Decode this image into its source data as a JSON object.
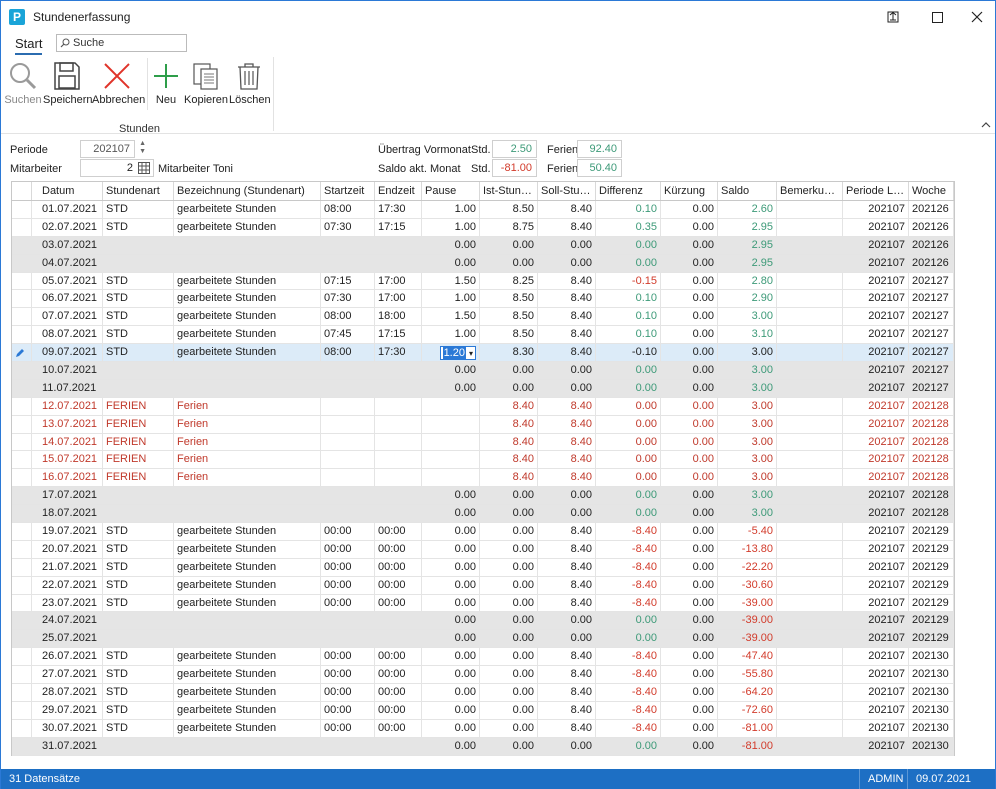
{
  "window": {
    "logo": "P",
    "title": "Stundenerfassung",
    "controls": [
      "restore-icon",
      "maximize-icon",
      "close-icon"
    ]
  },
  "ribbon": {
    "tab": "Start",
    "search_placeholder": "Suche",
    "buttons": {
      "suchen": "Suchen",
      "speichern": "Speichern",
      "abbrechen": "Abbrechen",
      "neu": "Neu",
      "kopieren": "Kopieren",
      "loeschen": "Löschen"
    },
    "group": "Stunden"
  },
  "form": {
    "periode_label": "Periode",
    "periode_value": "202107",
    "mitarbeiter_label": "Mitarbeiter",
    "mitarbeiter_value": "2",
    "mitarbeiter_name": "Mitarbeiter Toni",
    "uebertrag_label": "Übertrag Vormonat",
    "saldo_label": "Saldo akt. Monat",
    "std_label": "Std.",
    "ferien_label": "Ferien",
    "uebertrag_std": "2.50",
    "uebertrag_ferien": "92.40",
    "saldo_std": "-81.00",
    "saldo_ferien": "50.40"
  },
  "grid": {
    "columns": [
      "Datum",
      "Stundenart",
      "Bezeichnung (Stundenart)",
      "Startzeit",
      "Endzeit",
      "Pause",
      "Ist-Stunden",
      "Soll-Stund...",
      "Differenz",
      "Kürzung",
      "Saldo",
      "Bemerkungen",
      "Periode Lohn",
      "Woche"
    ],
    "rows": [
      {
        "t": "work",
        "datum": "01.07.2021",
        "art": "STD",
        "bez": "gearbeitete Stunden",
        "start": "08:00",
        "end": "17:30",
        "pause": "1.00",
        "ist": "8.50",
        "soll": "8.40",
        "diff": "0.10",
        "kurz": "0.00",
        "saldo": "2.60",
        "bem": "",
        "per": "202107",
        "woche": "202126"
      },
      {
        "t": "work",
        "datum": "02.07.2021",
        "art": "STD",
        "bez": "gearbeitete Stunden",
        "start": "07:30",
        "end": "17:15",
        "pause": "1.00",
        "ist": "8.75",
        "soll": "8.40",
        "diff": "0.35",
        "kurz": "0.00",
        "saldo": "2.95",
        "bem": "",
        "per": "202107",
        "woche": "202126"
      },
      {
        "t": "weekend",
        "datum": "03.07.2021",
        "art": "",
        "bez": "",
        "start": "",
        "end": "",
        "pause": "0.00",
        "ist": "0.00",
        "soll": "0.00",
        "diff": "0.00",
        "kurz": "0.00",
        "saldo": "2.95",
        "bem": "",
        "per": "202107",
        "woche": "202126"
      },
      {
        "t": "weekend",
        "datum": "04.07.2021",
        "art": "",
        "bez": "",
        "start": "",
        "end": "",
        "pause": "0.00",
        "ist": "0.00",
        "soll": "0.00",
        "diff": "0.00",
        "kurz": "0.00",
        "saldo": "2.95",
        "bem": "",
        "per": "202107",
        "woche": "202126"
      },
      {
        "t": "work",
        "datum": "05.07.2021",
        "art": "STD",
        "bez": "gearbeitete Stunden",
        "start": "07:15",
        "end": "17:00",
        "pause": "1.50",
        "ist": "8.25",
        "soll": "8.40",
        "diff": "-0.15",
        "kurz": "0.00",
        "saldo": "2.80",
        "bem": "",
        "per": "202107",
        "woche": "202127"
      },
      {
        "t": "work",
        "datum": "06.07.2021",
        "art": "STD",
        "bez": "gearbeitete Stunden",
        "start": "07:30",
        "end": "17:00",
        "pause": "1.00",
        "ist": "8.50",
        "soll": "8.40",
        "diff": "0.10",
        "kurz": "0.00",
        "saldo": "2.90",
        "bem": "",
        "per": "202107",
        "woche": "202127"
      },
      {
        "t": "work",
        "datum": "07.07.2021",
        "art": "STD",
        "bez": "gearbeitete Stunden",
        "start": "08:00",
        "end": "18:00",
        "pause": "1.50",
        "ist": "8.50",
        "soll": "8.40",
        "diff": "0.10",
        "kurz": "0.00",
        "saldo": "3.00",
        "bem": "",
        "per": "202107",
        "woche": "202127"
      },
      {
        "t": "work",
        "datum": "08.07.2021",
        "art": "STD",
        "bez": "gearbeitete Stunden",
        "start": "07:45",
        "end": "17:15",
        "pause": "1.00",
        "ist": "8.50",
        "soll": "8.40",
        "diff": "0.10",
        "kurz": "0.00",
        "saldo": "3.10",
        "bem": "",
        "per": "202107",
        "woche": "202127"
      },
      {
        "t": "sel",
        "datum": "09.07.2021",
        "art": "STD",
        "bez": "gearbeitete Stunden",
        "start": "08:00",
        "end": "17:30",
        "pause": "1.20",
        "ist": "8.30",
        "soll": "8.40",
        "diff": "-0.10",
        "kurz": "0.00",
        "saldo": "3.00",
        "bem": "",
        "per": "202107",
        "woche": "202127"
      },
      {
        "t": "weekend",
        "datum": "10.07.2021",
        "art": "",
        "bez": "",
        "start": "",
        "end": "",
        "pause": "0.00",
        "ist": "0.00",
        "soll": "0.00",
        "diff": "0.00",
        "kurz": "0.00",
        "saldo": "3.00",
        "bem": "",
        "per": "202107",
        "woche": "202127"
      },
      {
        "t": "weekend",
        "datum": "11.07.2021",
        "art": "",
        "bez": "",
        "start": "",
        "end": "",
        "pause": "0.00",
        "ist": "0.00",
        "soll": "0.00",
        "diff": "0.00",
        "kurz": "0.00",
        "saldo": "3.00",
        "bem": "",
        "per": "202107",
        "woche": "202127"
      },
      {
        "t": "ferien",
        "datum": "12.07.2021",
        "art": "FERIEN",
        "bez": "Ferien",
        "start": "",
        "end": "",
        "pause": "",
        "ist": "8.40",
        "soll": "8.40",
        "diff": "0.00",
        "kurz": "0.00",
        "saldo": "3.00",
        "bem": "",
        "per": "202107",
        "woche": "202128"
      },
      {
        "t": "ferien",
        "datum": "13.07.2021",
        "art": "FERIEN",
        "bez": "Ferien",
        "start": "",
        "end": "",
        "pause": "",
        "ist": "8.40",
        "soll": "8.40",
        "diff": "0.00",
        "kurz": "0.00",
        "saldo": "3.00",
        "bem": "",
        "per": "202107",
        "woche": "202128"
      },
      {
        "t": "ferien",
        "datum": "14.07.2021",
        "art": "FERIEN",
        "bez": "Ferien",
        "start": "",
        "end": "",
        "pause": "",
        "ist": "8.40",
        "soll": "8.40",
        "diff": "0.00",
        "kurz": "0.00",
        "saldo": "3.00",
        "bem": "",
        "per": "202107",
        "woche": "202128"
      },
      {
        "t": "ferien",
        "datum": "15.07.2021",
        "art": "FERIEN",
        "bez": "Ferien",
        "start": "",
        "end": "",
        "pause": "",
        "ist": "8.40",
        "soll": "8.40",
        "diff": "0.00",
        "kurz": "0.00",
        "saldo": "3.00",
        "bem": "",
        "per": "202107",
        "woche": "202128"
      },
      {
        "t": "ferien",
        "datum": "16.07.2021",
        "art": "FERIEN",
        "bez": "Ferien",
        "start": "",
        "end": "",
        "pause": "",
        "ist": "8.40",
        "soll": "8.40",
        "diff": "0.00",
        "kurz": "0.00",
        "saldo": "3.00",
        "bem": "",
        "per": "202107",
        "woche": "202128"
      },
      {
        "t": "weekend",
        "datum": "17.07.2021",
        "art": "",
        "bez": "",
        "start": "",
        "end": "",
        "pause": "0.00",
        "ist": "0.00",
        "soll": "0.00",
        "diff": "0.00",
        "kurz": "0.00",
        "saldo": "3.00",
        "bem": "",
        "per": "202107",
        "woche": "202128"
      },
      {
        "t": "weekend",
        "datum": "18.07.2021",
        "art": "",
        "bez": "",
        "start": "",
        "end": "",
        "pause": "0.00",
        "ist": "0.00",
        "soll": "0.00",
        "diff": "0.00",
        "kurz": "0.00",
        "saldo": "3.00",
        "bem": "",
        "per": "202107",
        "woche": "202128"
      },
      {
        "t": "work",
        "datum": "19.07.2021",
        "art": "STD",
        "bez": "gearbeitete Stunden",
        "start": "00:00",
        "end": "00:00",
        "pause": "0.00",
        "ist": "0.00",
        "soll": "8.40",
        "diff": "-8.40",
        "kurz": "0.00",
        "saldo": "-5.40",
        "bem": "",
        "per": "202107",
        "woche": "202129"
      },
      {
        "t": "work",
        "datum": "20.07.2021",
        "art": "STD",
        "bez": "gearbeitete Stunden",
        "start": "00:00",
        "end": "00:00",
        "pause": "0.00",
        "ist": "0.00",
        "soll": "8.40",
        "diff": "-8.40",
        "kurz": "0.00",
        "saldo": "-13.80",
        "bem": "",
        "per": "202107",
        "woche": "202129"
      },
      {
        "t": "work",
        "datum": "21.07.2021",
        "art": "STD",
        "bez": "gearbeitete Stunden",
        "start": "00:00",
        "end": "00:00",
        "pause": "0.00",
        "ist": "0.00",
        "soll": "8.40",
        "diff": "-8.40",
        "kurz": "0.00",
        "saldo": "-22.20",
        "bem": "",
        "per": "202107",
        "woche": "202129"
      },
      {
        "t": "work",
        "datum": "22.07.2021",
        "art": "STD",
        "bez": "gearbeitete Stunden",
        "start": "00:00",
        "end": "00:00",
        "pause": "0.00",
        "ist": "0.00",
        "soll": "8.40",
        "diff": "-8.40",
        "kurz": "0.00",
        "saldo": "-30.60",
        "bem": "",
        "per": "202107",
        "woche": "202129"
      },
      {
        "t": "work",
        "datum": "23.07.2021",
        "art": "STD",
        "bez": "gearbeitete Stunden",
        "start": "00:00",
        "end": "00:00",
        "pause": "0.00",
        "ist": "0.00",
        "soll": "8.40",
        "diff": "-8.40",
        "kurz": "0.00",
        "saldo": "-39.00",
        "bem": "",
        "per": "202107",
        "woche": "202129"
      },
      {
        "t": "weekend",
        "datum": "24.07.2021",
        "art": "",
        "bez": "",
        "start": "",
        "end": "",
        "pause": "0.00",
        "ist": "0.00",
        "soll": "0.00",
        "diff": "0.00",
        "kurz": "0.00",
        "saldo": "-39.00",
        "bem": "",
        "per": "202107",
        "woche": "202129"
      },
      {
        "t": "weekend",
        "datum": "25.07.2021",
        "art": "",
        "bez": "",
        "start": "",
        "end": "",
        "pause": "0.00",
        "ist": "0.00",
        "soll": "0.00",
        "diff": "0.00",
        "kurz": "0.00",
        "saldo": "-39.00",
        "bem": "",
        "per": "202107",
        "woche": "202129"
      },
      {
        "t": "work",
        "datum": "26.07.2021",
        "art": "STD",
        "bez": "gearbeitete Stunden",
        "start": "00:00",
        "end": "00:00",
        "pause": "0.00",
        "ist": "0.00",
        "soll": "8.40",
        "diff": "-8.40",
        "kurz": "0.00",
        "saldo": "-47.40",
        "bem": "",
        "per": "202107",
        "woche": "202130"
      },
      {
        "t": "work",
        "datum": "27.07.2021",
        "art": "STD",
        "bez": "gearbeitete Stunden",
        "start": "00:00",
        "end": "00:00",
        "pause": "0.00",
        "ist": "0.00",
        "soll": "8.40",
        "diff": "-8.40",
        "kurz": "0.00",
        "saldo": "-55.80",
        "bem": "",
        "per": "202107",
        "woche": "202130"
      },
      {
        "t": "work",
        "datum": "28.07.2021",
        "art": "STD",
        "bez": "gearbeitete Stunden",
        "start": "00:00",
        "end": "00:00",
        "pause": "0.00",
        "ist": "0.00",
        "soll": "8.40",
        "diff": "-8.40",
        "kurz": "0.00",
        "saldo": "-64.20",
        "bem": "",
        "per": "202107",
        "woche": "202130"
      },
      {
        "t": "work",
        "datum": "29.07.2021",
        "art": "STD",
        "bez": "gearbeitete Stunden",
        "start": "00:00",
        "end": "00:00",
        "pause": "0.00",
        "ist": "0.00",
        "soll": "8.40",
        "diff": "-8.40",
        "kurz": "0.00",
        "saldo": "-72.60",
        "bem": "",
        "per": "202107",
        "woche": "202130"
      },
      {
        "t": "work",
        "datum": "30.07.2021",
        "art": "STD",
        "bez": "gearbeitete Stunden",
        "start": "00:00",
        "end": "00:00",
        "pause": "0.00",
        "ist": "0.00",
        "soll": "8.40",
        "diff": "-8.40",
        "kurz": "0.00",
        "saldo": "-81.00",
        "bem": "",
        "per": "202107",
        "woche": "202130"
      },
      {
        "t": "weekend",
        "datum": "31.07.2021",
        "art": "",
        "bez": "",
        "start": "",
        "end": "",
        "pause": "0.00",
        "ist": "0.00",
        "soll": "0.00",
        "diff": "0.00",
        "kurz": "0.00",
        "saldo": "-81.00",
        "bem": "",
        "per": "202107",
        "woche": "202130"
      }
    ]
  },
  "statusbar": {
    "count": "31 Datensätze",
    "user": "ADMIN",
    "date": "09.07.2021"
  }
}
